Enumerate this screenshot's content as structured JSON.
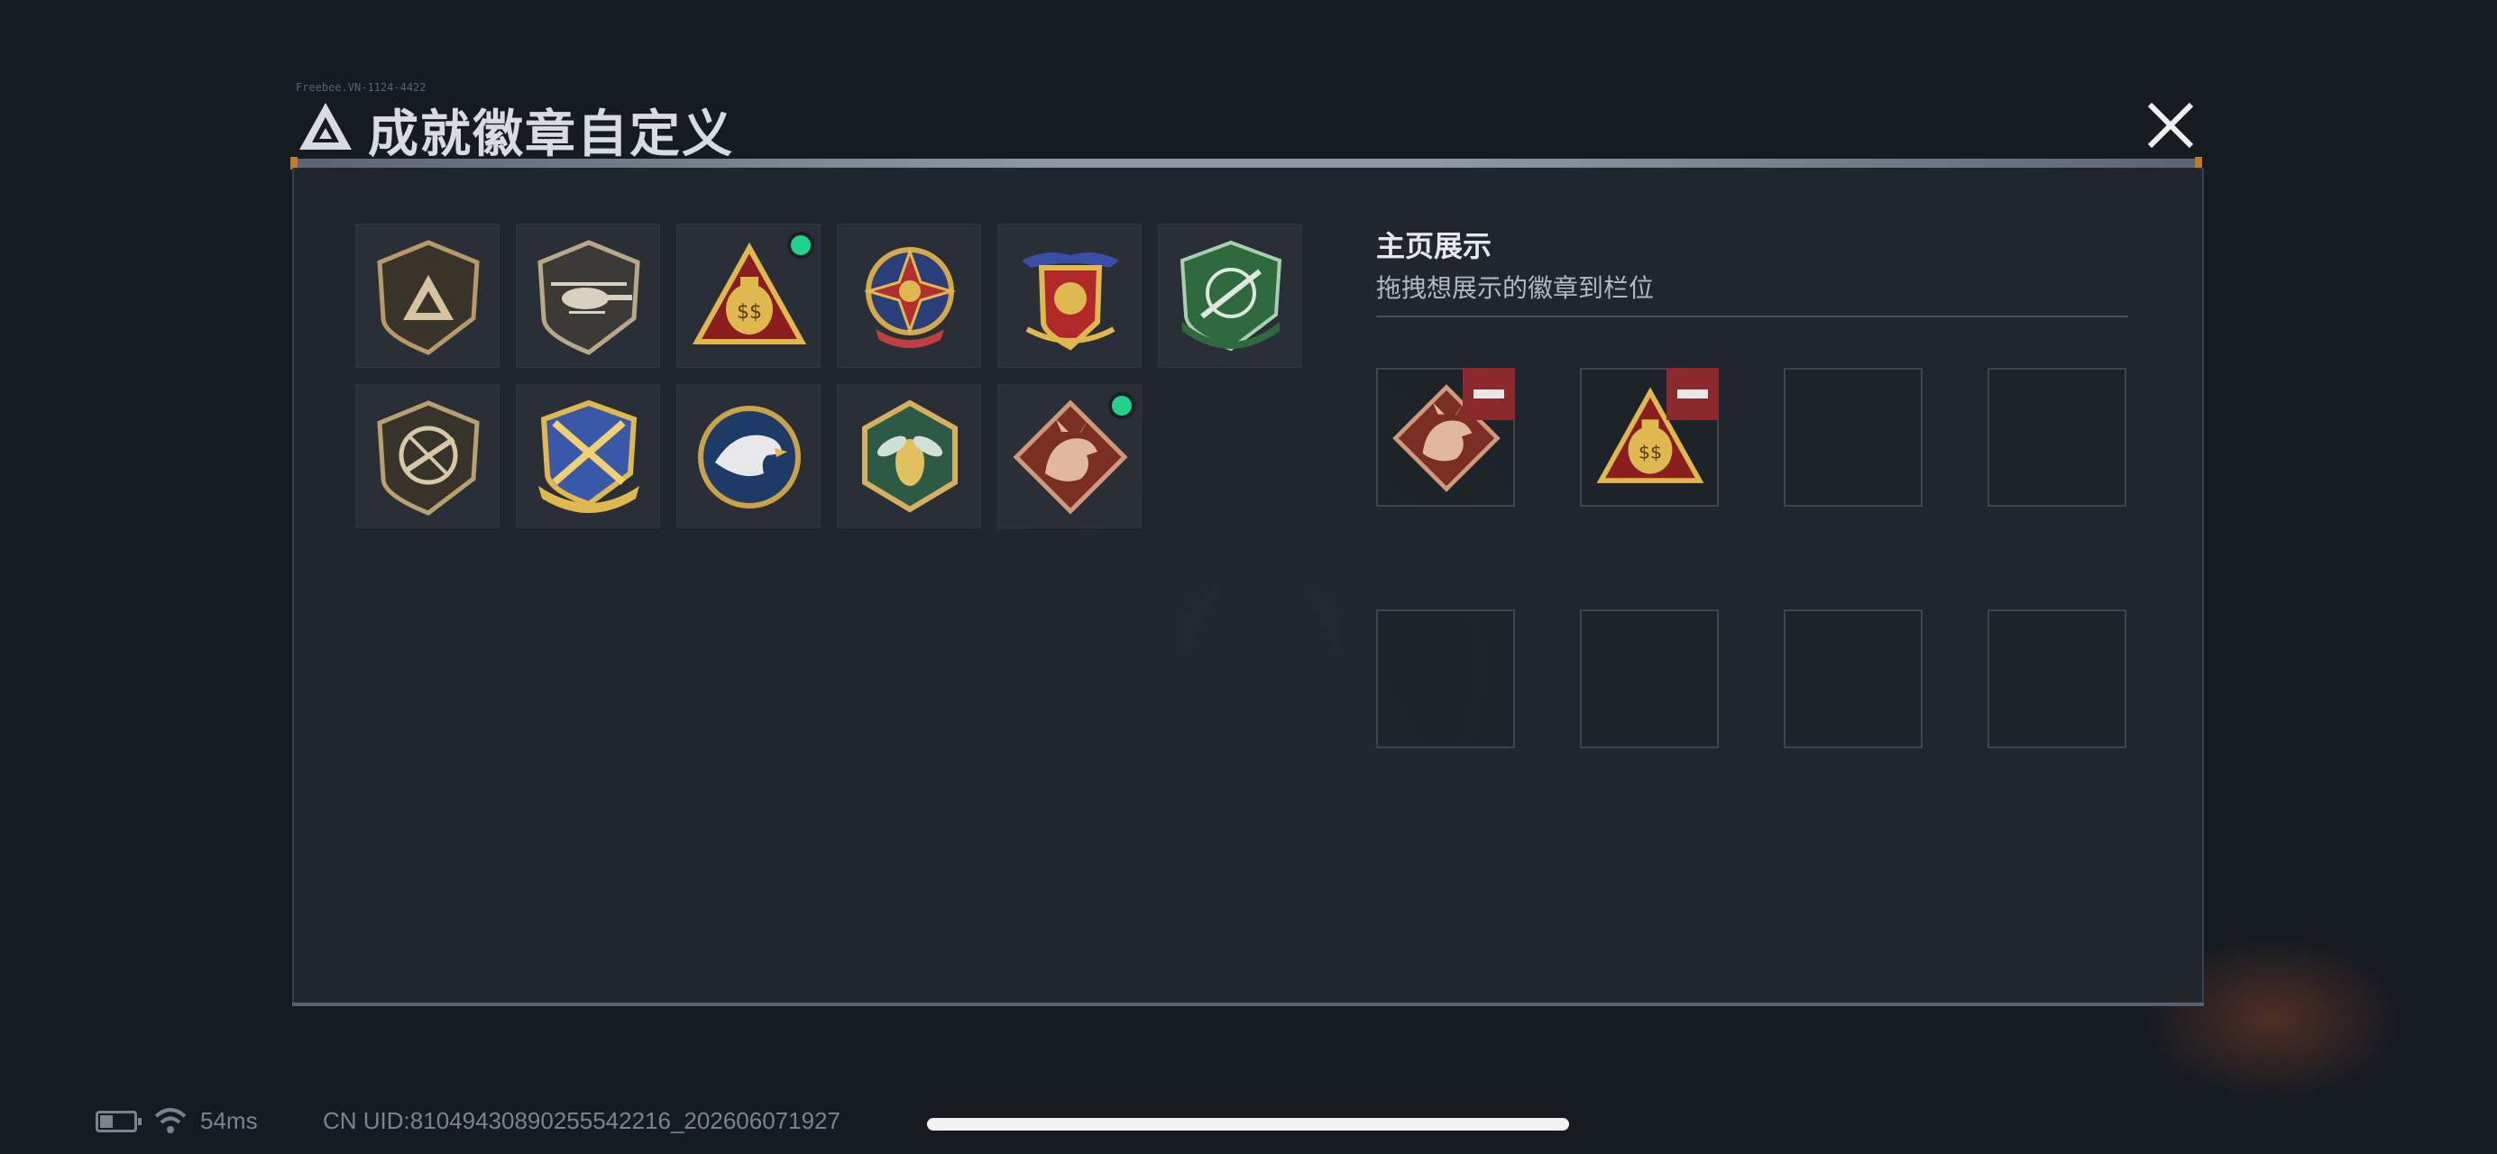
{
  "window": {
    "title": "成就徽章自定义",
    "title_small": "Freebee.VN-1124-4422",
    "close_icon": "close-icon"
  },
  "badges": [
    {
      "name": "delta-shield-badge",
      "new": false
    },
    {
      "name": "helicopter-badge",
      "new": false
    },
    {
      "name": "money-bag-badge",
      "new": true
    },
    {
      "name": "star-compass-badge",
      "new": false
    },
    {
      "name": "winged-crest-badge",
      "new": false
    },
    {
      "name": "rifle-scope-badge",
      "new": false
    },
    {
      "name": "no-rifle-badge",
      "new": false
    },
    {
      "name": "crossed-rifles-badge",
      "new": false
    },
    {
      "name": "eagle-badge",
      "new": false
    },
    {
      "name": "hornet-badge",
      "new": false
    },
    {
      "name": "dragon-badge",
      "new": true
    }
  ],
  "display": {
    "title": "主页展示",
    "subtitle": "拖拽想展示的徽章到栏位",
    "slots": [
      {
        "badge": "dragon-badge",
        "removable": true
      },
      {
        "badge": "money-bag-badge",
        "removable": true
      },
      {
        "badge": null
      },
      {
        "badge": null
      },
      {
        "badge": null
      },
      {
        "badge": null
      },
      {
        "badge": null
      },
      {
        "badge": null
      }
    ]
  },
  "status": {
    "ping": "54ms",
    "uid": "CN UID:8104943089025554221​6_202606071927"
  },
  "colors": {
    "new_dot": "#1fd38a",
    "remove_button": "#8b2a2e",
    "gold": "#c9a24a"
  }
}
